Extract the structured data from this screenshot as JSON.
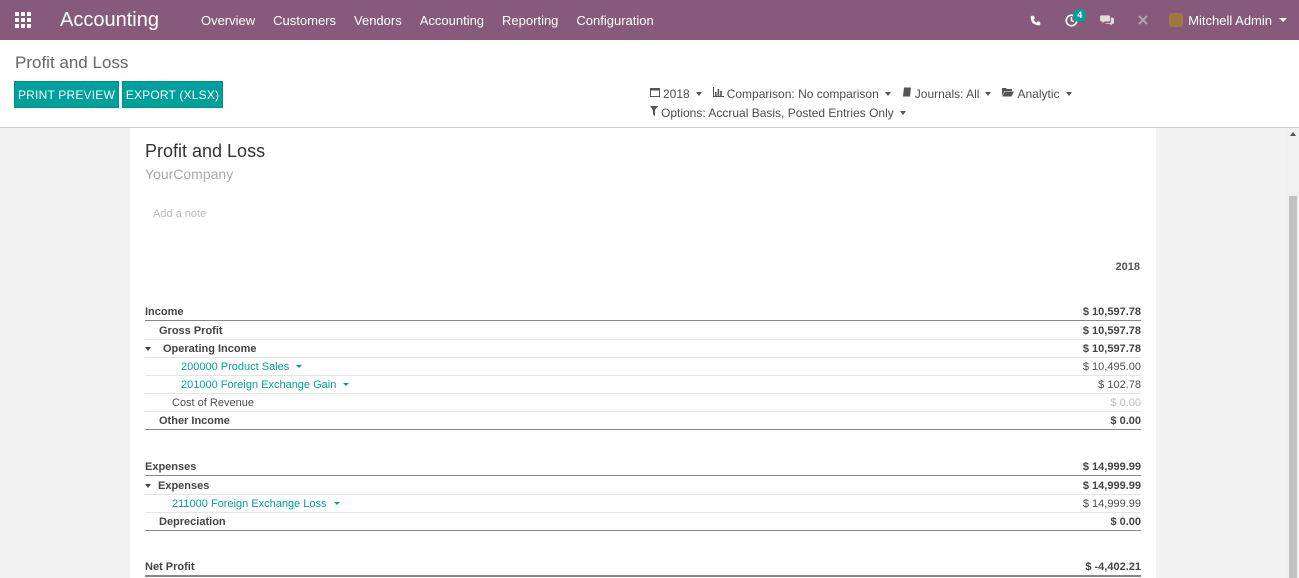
{
  "navbar": {
    "brand": "Accounting",
    "menu": [
      "Overview",
      "Customers",
      "Vendors",
      "Accounting",
      "Reporting",
      "Configuration"
    ],
    "activity_count": "4",
    "user_name": "Mitchell Admin",
    "color": "#875a7b"
  },
  "control_panel": {
    "title": "Profit and Loss",
    "print_label": "PRINT PREVIEW",
    "export_label": "EXPORT (XLSX)",
    "filters": {
      "date": "2018",
      "comparison": "Comparison: No comparison",
      "journals": "Journals: All",
      "analytic": "Analytic",
      "options": "Options: Accrual Basis, Posted Entries Only"
    },
    "accent": "#00a09d"
  },
  "report": {
    "title": "Profit and Loss",
    "company": "YourCompany",
    "note_placeholder": "Add a note",
    "column": "2018",
    "rows": [
      {
        "label": "Income",
        "value": "$ 10,597.78"
      },
      {
        "label": "Gross Profit",
        "value": "$ 10,597.78"
      },
      {
        "label": "Operating Income",
        "value": "$ 10,597.78"
      },
      {
        "label": "200000 Product Sales",
        "value": "$ 10,495.00"
      },
      {
        "label": "201000 Foreign Exchange Gain",
        "value": "$ 102.78"
      },
      {
        "label": "Cost of Revenue",
        "value": "$ 0.00"
      },
      {
        "label": "Other Income",
        "value": "$ 0.00"
      },
      {
        "label": "Expenses",
        "value": "$ 14,999.99"
      },
      {
        "label": "Expenses",
        "value": "$ 14,999.99"
      },
      {
        "label": "211000 Foreign Exchange Loss",
        "value": "$ 14,999.99"
      },
      {
        "label": "Depreciation",
        "value": "$ 0.00"
      },
      {
        "label": "Net Profit",
        "value": "$ -4,402.21"
      }
    ]
  }
}
